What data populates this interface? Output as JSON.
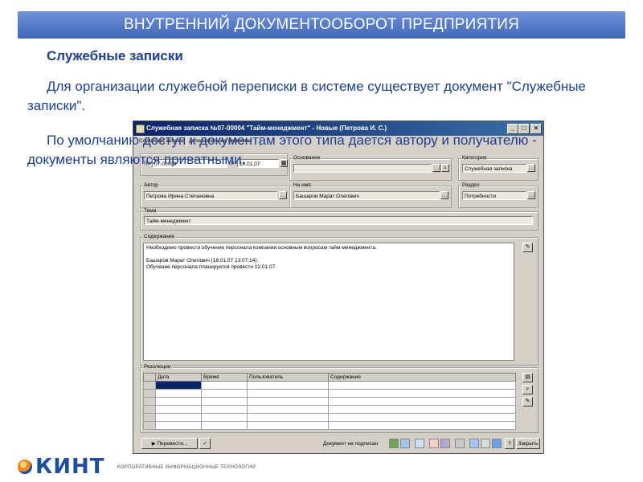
{
  "slide": {
    "banner": "ВНУТРЕННИЙ ДОКУМЕНТООБОРОТ ПРЕДПРИЯТИЯ",
    "heading": "Служебные записки",
    "paragraph1": "Для организации служебной переписки в системе существует документ \"Служебные записки\".",
    "paragraph2": "По умолчанию доступ к документам этого типа дается автору и получателю - документы являются приватными."
  },
  "window": {
    "title": "Служебная записка №07-00004 \"Тайм-менеджмент\" - Новые (Петрова И. С.)",
    "tabs": [
      "Служебная записка",
      "Дополнительные реквизиты"
    ],
    "number_label": "№",
    "number_value": "07-00004",
    "date_label": "от",
    "date_value": "10.01.07",
    "basis_label": "Основание",
    "category_label": "Категория",
    "category_value": "Служебная записка",
    "author_label": "Автор",
    "author_value": "Петрова Ирина Степановна",
    "addressee_label": "На имя",
    "addressee_value": "Башаров Марат Олегович",
    "section_label": "Раздел",
    "section_value": "Потребности",
    "subject_label": "Тема",
    "subject_value": "Тайм-менеджмент",
    "content_label": "Содержание",
    "content_lines": [
      "Необходимо провести обучение персонала компании основным вопросам тайм-менеджмента.",
      "",
      "Башаров Марат Олегович (18.01.07 13:07:14):",
      "Обучение персонала планируется провести 12.01.07"
    ],
    "resolutions_label": "Резолюции",
    "columns": [
      "Дата",
      "Время",
      "Пользователь",
      "Содержание"
    ],
    "forward_button": "Перевести...",
    "status_text": "Документ не подписан",
    "close_button": "Закрыть"
  },
  "footer": {
    "logo_name": "КИНТ",
    "logo_tagline": "КОРПОРАТИВНЫЕ ИНФОРМАЦИОННЫЕ ТЕХНОЛОГИИ"
  }
}
